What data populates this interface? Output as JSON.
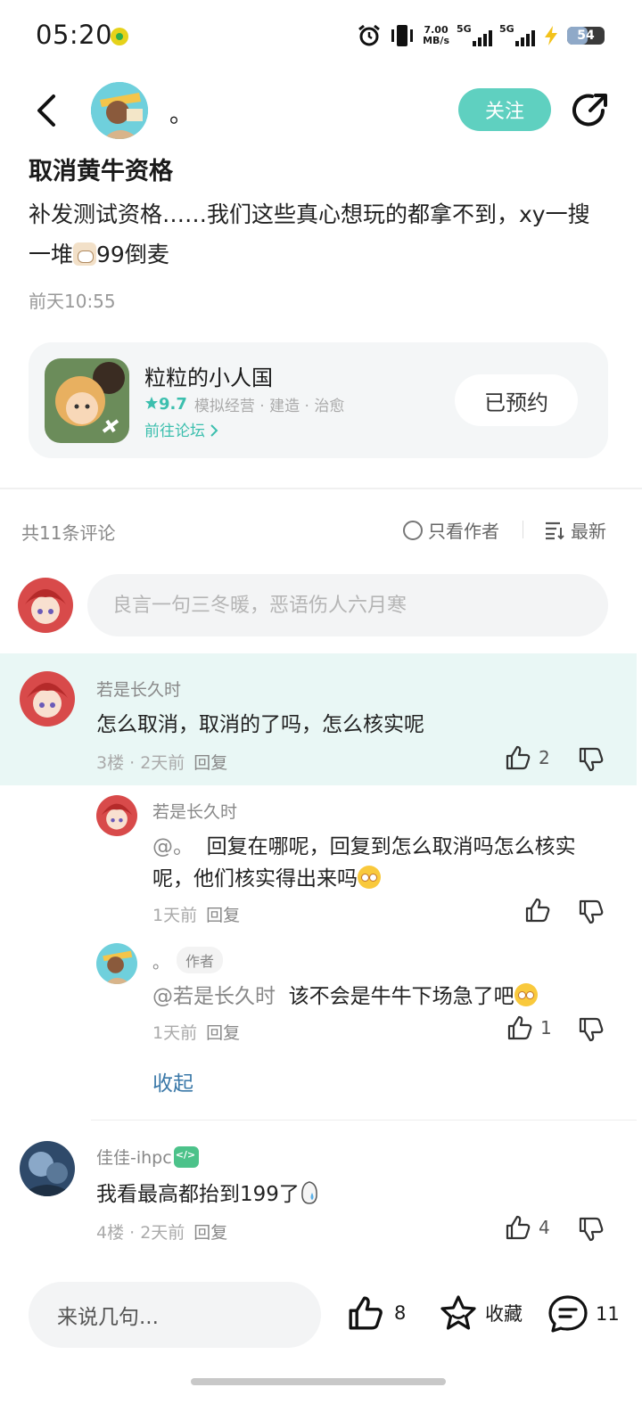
{
  "status_bar": {
    "time": "05:20",
    "speed_value": "7.00",
    "speed_unit": "MB/s",
    "net1": "5G",
    "net2": "5G",
    "battery": "54",
    "battery_level": 0.54
  },
  "header": {
    "user_name": "。",
    "follow_label": "关注"
  },
  "post": {
    "title": "取消黄牛资格",
    "body_part1": "补发测试资格……我们这些真心想玩的都拿不到，xy一搜一堆",
    "body_part2": "99倒麦",
    "time": "前天10:55"
  },
  "game": {
    "name": "粒粒的小人国",
    "score": "9.7",
    "tags": "模拟经营 · 建造 · 治愈",
    "forum_link": "前往论坛",
    "reserve_label": "已预约"
  },
  "comments_header": {
    "count_label": "共11条评论",
    "only_author": "只看作者",
    "sort": "最新"
  },
  "comment_input": {
    "placeholder": "良言一句三冬暖，恶语伤人六月寒"
  },
  "comments": [
    {
      "user": "若是长久时",
      "text": "怎么取消，取消的了吗，怎么核实呢",
      "meta": "3楼 · 2天前",
      "reply": "回复",
      "likes": "2",
      "replies": [
        {
          "user": "若是长久时",
          "mention": "@。",
          "text": "回复在哪呢，回复到怎么取消吗怎么核实呢，他们核实得出来吗",
          "meta": "1天前",
          "reply": "回复",
          "likes": ""
        },
        {
          "user": "。",
          "tag": "作者",
          "mention": "@若是长久时",
          "text": "该不会是牛牛下场急了吧",
          "meta": "1天前",
          "reply": "回复",
          "likes": "1"
        }
      ],
      "collapse": "收起"
    },
    {
      "user": "佳佳-ihpc",
      "text": "我看最高都抬到199了",
      "meta": "4楼 · 2天前",
      "reply": "回复",
      "likes": "4"
    }
  ],
  "bottom_bar": {
    "input_label": "来说几句...",
    "likes": "8",
    "favorite": "收藏",
    "comments": "11"
  }
}
